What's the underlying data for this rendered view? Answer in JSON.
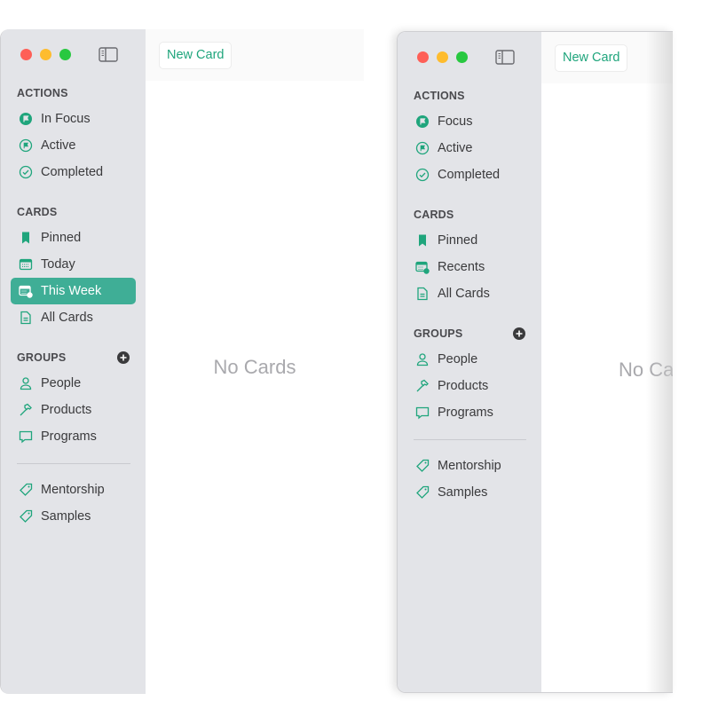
{
  "colors": {
    "accent": "#1fa57c",
    "selected_bg": "#3fae96",
    "sidebar_bg": "#e3e4e8",
    "close": "#fe5f57",
    "minimize": "#febc2e",
    "zoom": "#28c840",
    "empty_text": "#a9a9ad"
  },
  "windows": [
    {
      "id": "left",
      "toolbar": {
        "new_card_label": "New Card"
      },
      "empty_text": "No Cards",
      "sections": [
        {
          "header": "ACTIONS",
          "items": [
            {
              "label": "In Focus",
              "icon": "flag-filled-circle-icon"
            },
            {
              "label": "Active",
              "icon": "flag-circle-icon"
            },
            {
              "label": "Completed",
              "icon": "check-circle-icon"
            }
          ]
        },
        {
          "header": "CARDS",
          "items": [
            {
              "label": "Pinned",
              "icon": "bookmark-icon"
            },
            {
              "label": "Today",
              "icon": "calendar-icon"
            },
            {
              "label": "This Week",
              "icon": "calendar-check-icon",
              "selected": true
            },
            {
              "label": "All Cards",
              "icon": "document-icon"
            }
          ]
        },
        {
          "header": "GROUPS",
          "add_button": true,
          "items": [
            {
              "label": "People",
              "icon": "person-icon"
            },
            {
              "label": "Products",
              "icon": "hammer-icon"
            },
            {
              "label": "Programs",
              "icon": "speech-bubble-icon"
            }
          ]
        },
        {
          "divider": true,
          "items": [
            {
              "label": "Mentorship",
              "icon": "tag-icon"
            },
            {
              "label": "Samples",
              "icon": "tag-icon"
            }
          ]
        }
      ]
    },
    {
      "id": "right",
      "toolbar": {
        "new_card_label": "New Card"
      },
      "empty_text": "No Cards",
      "sections": [
        {
          "header": "ACTIONS",
          "items": [
            {
              "label": "Focus",
              "icon": "flag-filled-circle-icon"
            },
            {
              "label": "Active",
              "icon": "flag-circle-icon"
            },
            {
              "label": "Completed",
              "icon": "check-circle-icon"
            }
          ]
        },
        {
          "header": "CARDS",
          "items": [
            {
              "label": "Pinned",
              "icon": "bookmark-icon"
            },
            {
              "label": "Recents",
              "icon": "calendar-check-icon"
            },
            {
              "label": "All Cards",
              "icon": "document-icon"
            }
          ]
        },
        {
          "header": "GROUPS",
          "add_button": true,
          "items": [
            {
              "label": "People",
              "icon": "person-icon"
            },
            {
              "label": "Products",
              "icon": "hammer-icon"
            },
            {
              "label": "Programs",
              "icon": "speech-bubble-icon"
            }
          ]
        },
        {
          "divider": true,
          "items": [
            {
              "label": "Mentorship",
              "icon": "tag-icon"
            },
            {
              "label": "Samples",
              "icon": "tag-icon"
            }
          ]
        }
      ]
    }
  ]
}
